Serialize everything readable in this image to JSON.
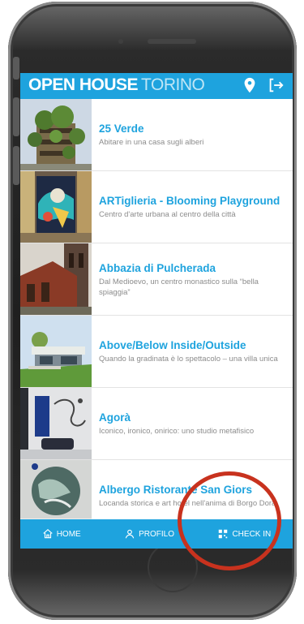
{
  "app": {
    "brand_bold": "OPEN HOUSE",
    "brand_light": "TORINO",
    "header_icons": [
      "location-pin-icon",
      "logout-icon"
    ]
  },
  "places": [
    {
      "title": "25 Verde",
      "subtitle": "Abitare in una casa sugli alberi"
    },
    {
      "title": "ARTiglieria - Blooming Playground",
      "subtitle": "Centro d'arte urbana al centro della città"
    },
    {
      "title": "Abbazia di Pulcherada",
      "subtitle": "Dal Medioevo, un centro monastico sulla “bella spiaggia”"
    },
    {
      "title": "Above/Below Inside/Outside",
      "subtitle": "Quando la gradinata è lo spettacolo – una villa unica"
    },
    {
      "title": "Agorà",
      "subtitle": "Iconico, ironico, onirico: uno studio metafisico"
    },
    {
      "title": "Albergo Ristorante San Giors",
      "subtitle": "Locanda storica e art hotel nell'anima di Borgo Dora"
    }
  ],
  "tabs": {
    "home": "HOME",
    "profile": "PROFILO",
    "checkin": "CHECK IN"
  },
  "colors": {
    "accent": "#1ea3de",
    "highlight_ring": "#c8321e"
  }
}
